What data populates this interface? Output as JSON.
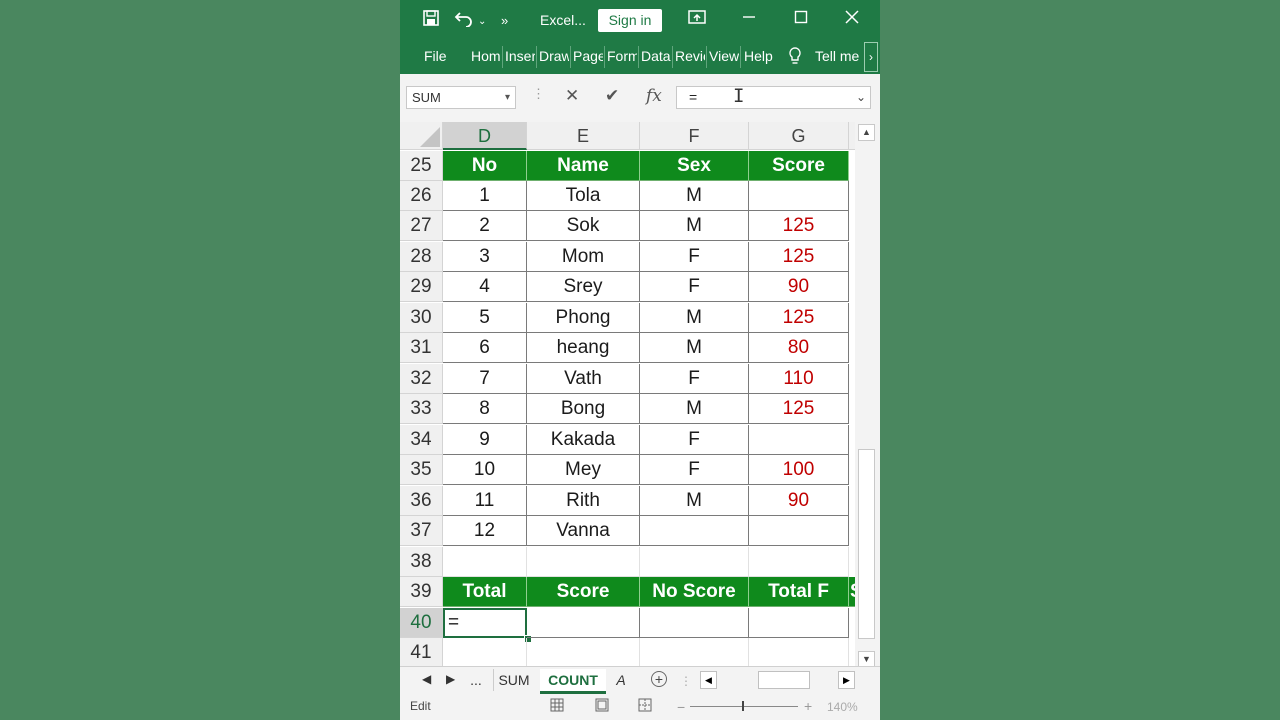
{
  "titlebar": {
    "app_name": "Excel...",
    "sign_in": "Sign in"
  },
  "ribbon": {
    "tabs": [
      "File",
      "Hom",
      "Inser",
      "Draw",
      "Page",
      "Form",
      "Data",
      "Revie",
      "View",
      "Help"
    ],
    "tell_me": "Tell me"
  },
  "formula_bar": {
    "name_box": "SUM",
    "formula": "="
  },
  "columns": [
    "D",
    "E",
    "F",
    "G"
  ],
  "rows": [
    "25",
    "26",
    "27",
    "28",
    "29",
    "30",
    "31",
    "32",
    "33",
    "34",
    "35",
    "36",
    "37",
    "38",
    "39",
    "40",
    "41"
  ],
  "table": {
    "headers": [
      "No",
      "Name",
      "Sex",
      "Score"
    ],
    "records": [
      [
        "1",
        "Tola",
        "M",
        ""
      ],
      [
        "2",
        "Sok",
        "M",
        "125"
      ],
      [
        "3",
        "Mom",
        "F",
        "125"
      ],
      [
        "4",
        "Srey",
        "F",
        "90"
      ],
      [
        "5",
        "Phong",
        "M",
        "125"
      ],
      [
        "6",
        "heang",
        "M",
        "80"
      ],
      [
        "7",
        "Vath",
        "F",
        "110"
      ],
      [
        "8",
        "Bong",
        "M",
        "125"
      ],
      [
        "9",
        "Kakada",
        "F",
        ""
      ],
      [
        "10",
        "Mey",
        "F",
        "100"
      ],
      [
        "11",
        "Rith",
        "M",
        "90"
      ],
      [
        "12",
        "Vanna",
        "",
        ""
      ]
    ]
  },
  "summary": {
    "headers": [
      "Total",
      "Score",
      "No Score",
      "Total F",
      "S"
    ],
    "active_cell_value": "="
  },
  "sheets": {
    "more": "...",
    "tabs": [
      "SUM",
      "COUNT",
      "A"
    ],
    "active": "COUNT"
  },
  "status": {
    "mode": "Edit",
    "zoom": "140%"
  },
  "colors": {
    "title_green": "#1f7a45",
    "header_green": "#0f8a1c",
    "score_red": "#c00000",
    "background": "#4a875f"
  }
}
